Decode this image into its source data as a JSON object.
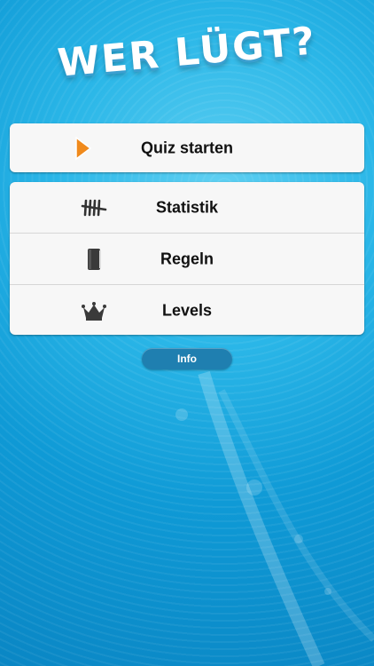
{
  "app": {
    "title": "WER LÜGT?"
  },
  "quiz": {
    "label": "Quiz starten",
    "icon": "play-icon"
  },
  "menu": {
    "items": [
      {
        "label": "Statistik",
        "icon": "tally-marks-icon"
      },
      {
        "label": "Regeln",
        "icon": "book-icon"
      },
      {
        "label": "Levels",
        "icon": "crown-icon"
      }
    ]
  },
  "info": {
    "label": "Info"
  },
  "colors": {
    "accent_orange": "#f08a1c",
    "button_blue": "#1f7fb0",
    "background": "#16a6dd"
  }
}
